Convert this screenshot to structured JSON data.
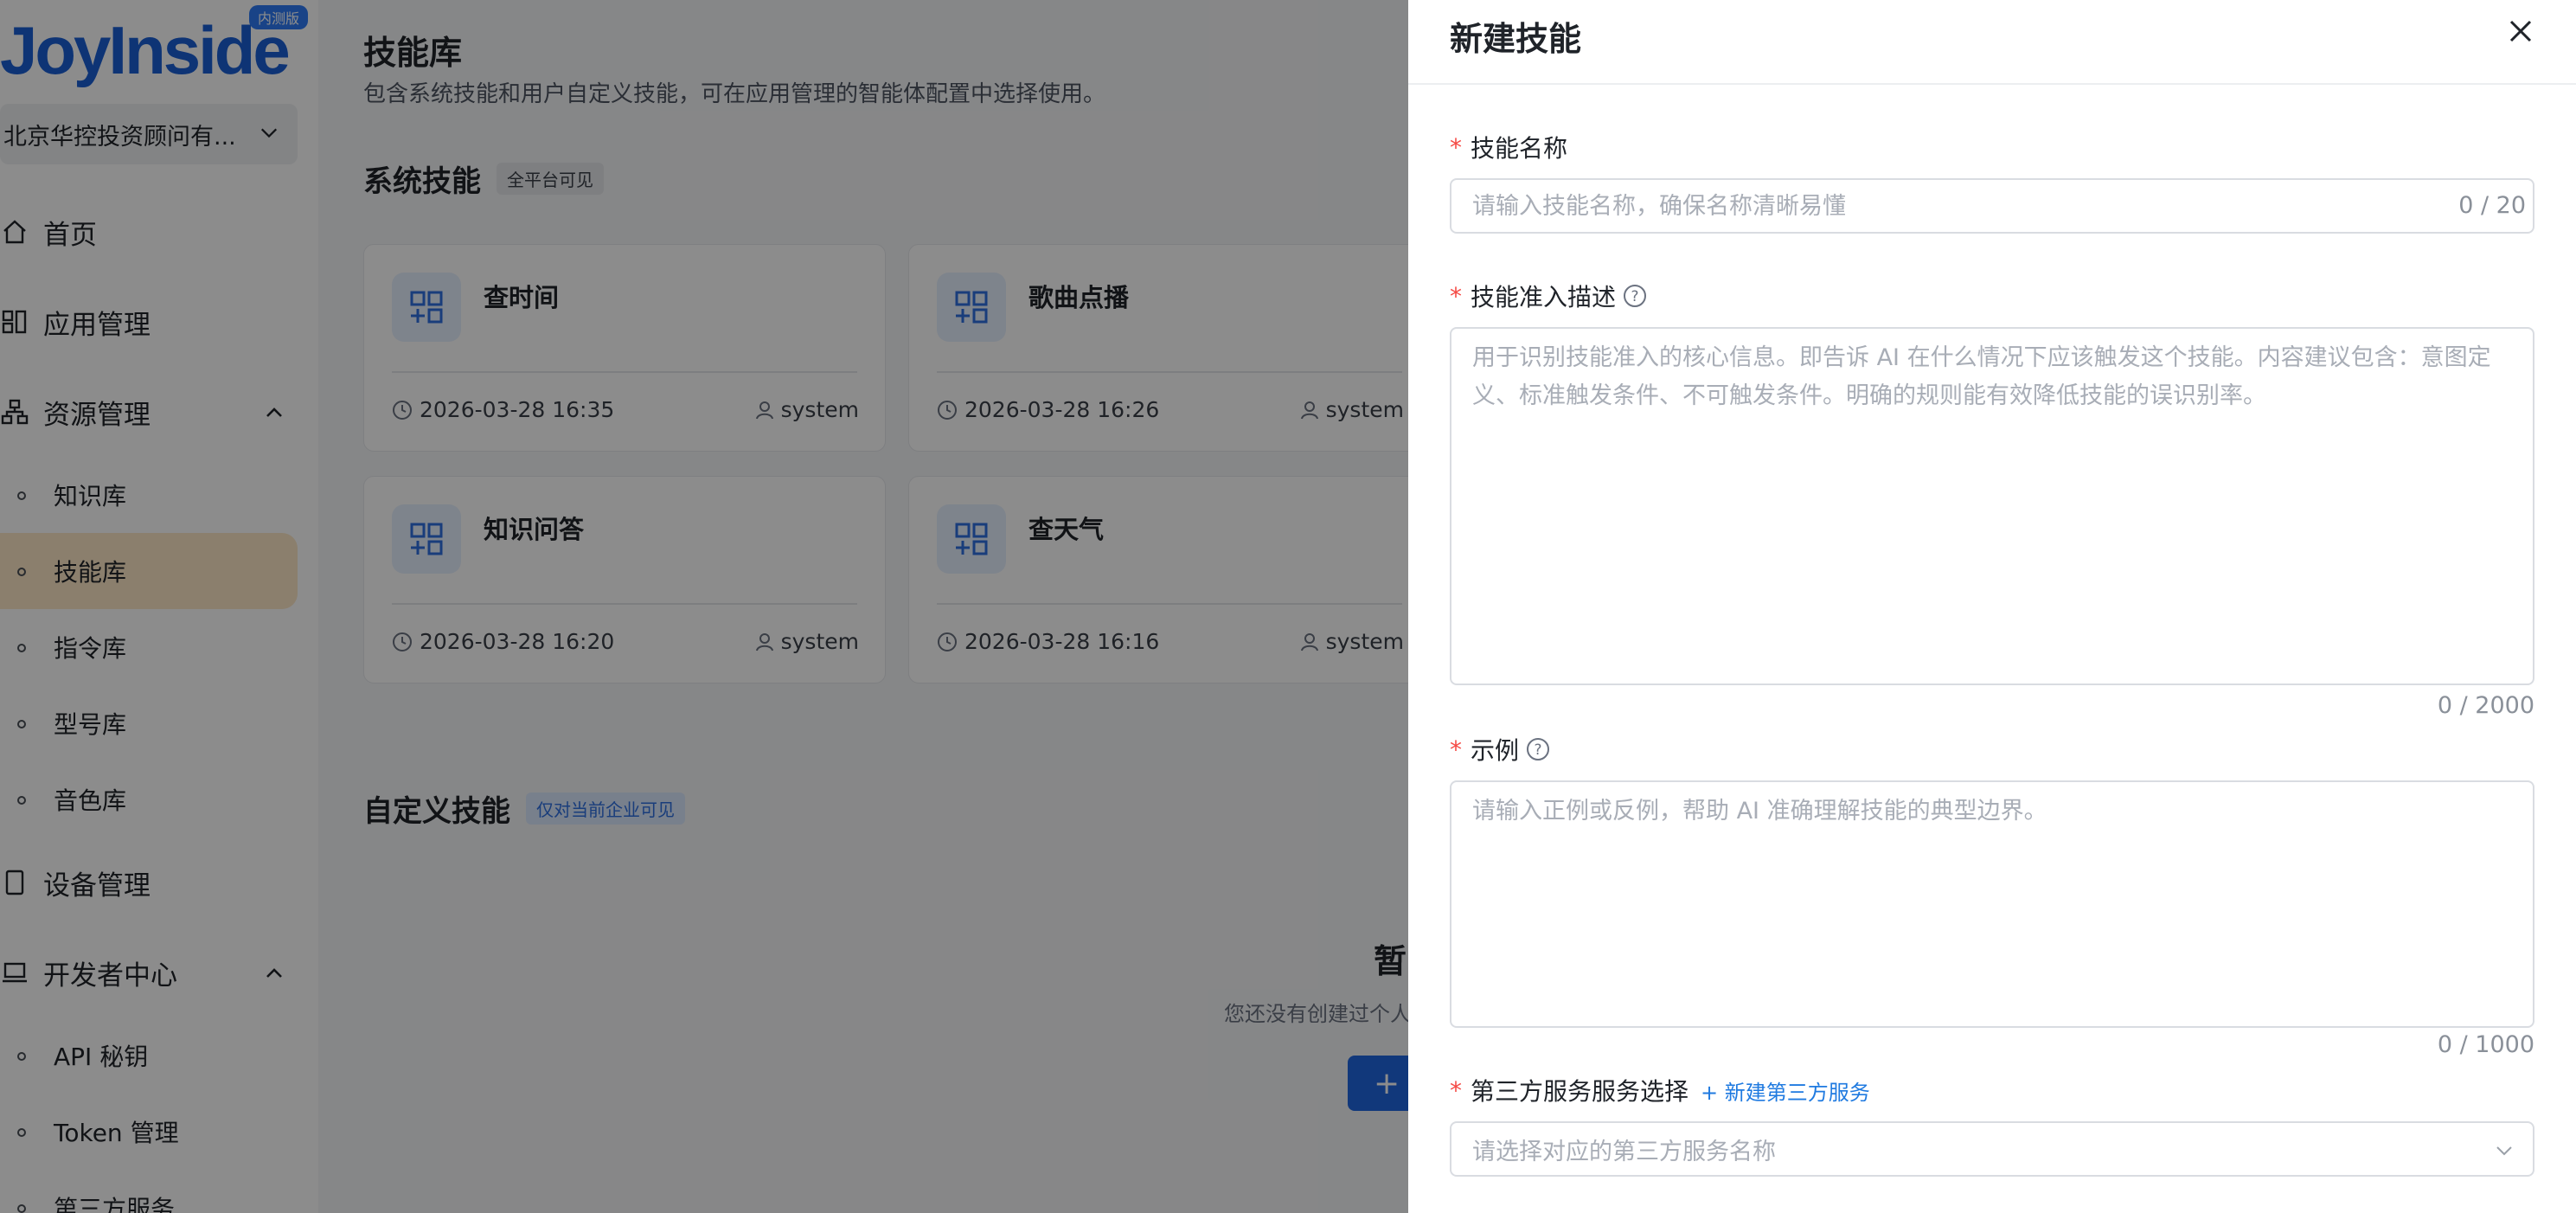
{
  "sidebar": {
    "logo_text": "JoyInside",
    "logo_badge": "内测版",
    "org_name": "北京华控投资顾问有...",
    "nav": [
      {
        "label": "首页"
      },
      {
        "label": "应用管理"
      },
      {
        "label": "资源管理"
      },
      {
        "label": "设备管理"
      },
      {
        "label": "开发者中心"
      }
    ],
    "resource_sub": [
      "知识库",
      "技能库",
      "指令库",
      "型号库",
      "音色库"
    ],
    "dev_sub": [
      "API 秘钥",
      "Token 管理",
      "第三方服务"
    ]
  },
  "main": {
    "title": "技能库",
    "subtitle": "包含系统技能和用户自定义技能，可在应用管理的智能体配置中选择使用。",
    "system_section": {
      "title": "系统技能",
      "tag": "全平台可见"
    },
    "cards": [
      {
        "name": "查时间",
        "date": "2026-03-28 16:35",
        "user": "system"
      },
      {
        "name": "歌曲点播",
        "date": "2026-03-28 16:26",
        "user": "system"
      },
      {
        "name": "知识问答",
        "date": "2026-03-28 16:20",
        "user": "system"
      },
      {
        "name": "查天气",
        "date": "2026-03-28 16:16",
        "user": "system"
      }
    ],
    "custom_section": {
      "title": "自定义技能",
      "tag": "仅对当前企业可见"
    },
    "empty_title": "暂",
    "empty_desc": "您还没有创建过个人",
    "create_icon": "+"
  },
  "drawer": {
    "title": "新建技能",
    "fields": {
      "name": {
        "label": "技能名称",
        "placeholder": "请输入技能名称，确保名称清晰易懂",
        "count": "0 / 20"
      },
      "desc": {
        "label": "技能准入描述",
        "placeholder": "用于识别技能准入的核心信息。即告诉 AI 在什么情况下应该触发这个技能。内容建议包含：意图定义、标准触发条件、不可触发条件。明确的规则能有效降低技能的误识别率。",
        "count": "0 / 2000"
      },
      "example": {
        "label": "示例",
        "placeholder": "请输入正例或反例，帮助 AI 准确理解技能的典型边界。",
        "count": "0 / 1000"
      },
      "service": {
        "label": "第三方服务服务选择",
        "link": "+ 新建第三方服务",
        "placeholder": "请选择对应的第三方服务名称"
      }
    }
  },
  "colors": {
    "accent": "#1f66e0",
    "active_bg": "#fde7c6",
    "required": "#f54a45",
    "link": "#1f7ae0"
  }
}
